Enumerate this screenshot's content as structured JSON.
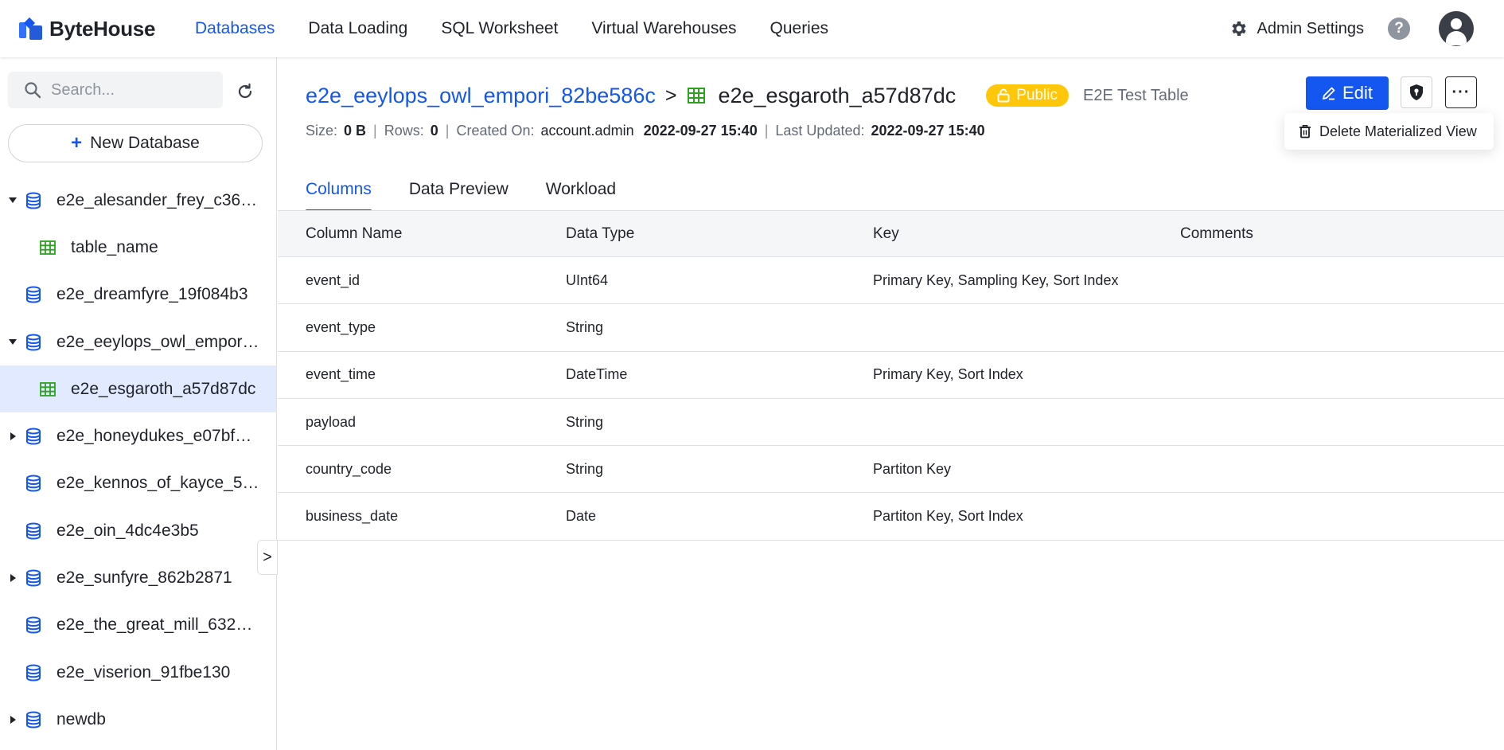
{
  "header": {
    "logo_text": "ByteHouse",
    "nav": [
      "Databases",
      "Data Loading",
      "SQL Worksheet",
      "Virtual Warehouses",
      "Queries"
    ],
    "admin_label": "Admin Settings",
    "help_glyph": "?"
  },
  "sidebar": {
    "search_placeholder": "Search...",
    "new_database_label": "New Database",
    "tree": [
      {
        "label": "e2e_alesander_frey_c36…",
        "type": "database",
        "expand": "down"
      },
      {
        "label": "table_name",
        "type": "table"
      },
      {
        "label": "e2e_dreamfyre_19f084b3",
        "type": "database",
        "expand": "none"
      },
      {
        "label": "e2e_eeylops_owl_empor…",
        "type": "database",
        "expand": "down"
      },
      {
        "label": "e2e_esgaroth_a57d87dc",
        "type": "table",
        "selected": true
      },
      {
        "label": "e2e_honeydukes_e07bf…",
        "type": "database",
        "expand": "right"
      },
      {
        "label": "e2e_kennos_of_kayce_5…",
        "type": "database",
        "expand": "none"
      },
      {
        "label": "e2e_oin_4dc4e3b5",
        "type": "database",
        "expand": "none"
      },
      {
        "label": "e2e_sunfyre_862b2871",
        "type": "database",
        "expand": "right"
      },
      {
        "label": "e2e_the_great_mill_632…",
        "type": "database",
        "expand": "none"
      },
      {
        "label": "e2e_viserion_91fbe130",
        "type": "database",
        "expand": "none"
      },
      {
        "label": "newdb",
        "type": "database",
        "expand": "right"
      }
    ],
    "collapse_glyph": ">"
  },
  "main": {
    "db_name": "e2e_eeylops_owl_empori_82be586c",
    "separator": ">",
    "table_name": "e2e_esgaroth_a57d87dc",
    "badge": "Public",
    "description": "E2E Test Table",
    "meta": {
      "size_label": "Size:",
      "size_value": "0 B",
      "rows_label": "Rows:",
      "rows_value": "0",
      "created_label": "Created On:",
      "created_by": "account.admin",
      "created_at": "2022-09-27 15:40",
      "updated_label": "Last Updated:",
      "updated_at": "2022-09-27 15:40"
    },
    "edit_label": "Edit",
    "more_glyph": "···",
    "dropdown_item": "Delete Materialized View",
    "tabs": [
      "Columns",
      "Data Preview",
      "Workload"
    ],
    "columns_header": [
      "Column Name",
      "Data Type",
      "Key",
      "Comments"
    ],
    "columns": [
      {
        "name": "event_id",
        "type": "UInt64",
        "key": "Primary Key, Sampling Key, Sort Index",
        "comment": ""
      },
      {
        "name": "event_type",
        "type": "String",
        "key": "",
        "comment": ""
      },
      {
        "name": "event_time",
        "type": "DateTime",
        "key": "Primary Key, Sort Index",
        "comment": ""
      },
      {
        "name": "payload",
        "type": "String",
        "key": "",
        "comment": ""
      },
      {
        "name": "country_code",
        "type": "String",
        "key": "Partiton Key",
        "comment": ""
      },
      {
        "name": "business_date",
        "type": "Date",
        "key": "Partiton Key, Sort Index",
        "comment": ""
      }
    ]
  },
  "colors": {
    "accent": "#1456f0",
    "badge": "#ffc60a",
    "selected_row": "#e1eaff",
    "table_icon": "#2ea121"
  }
}
